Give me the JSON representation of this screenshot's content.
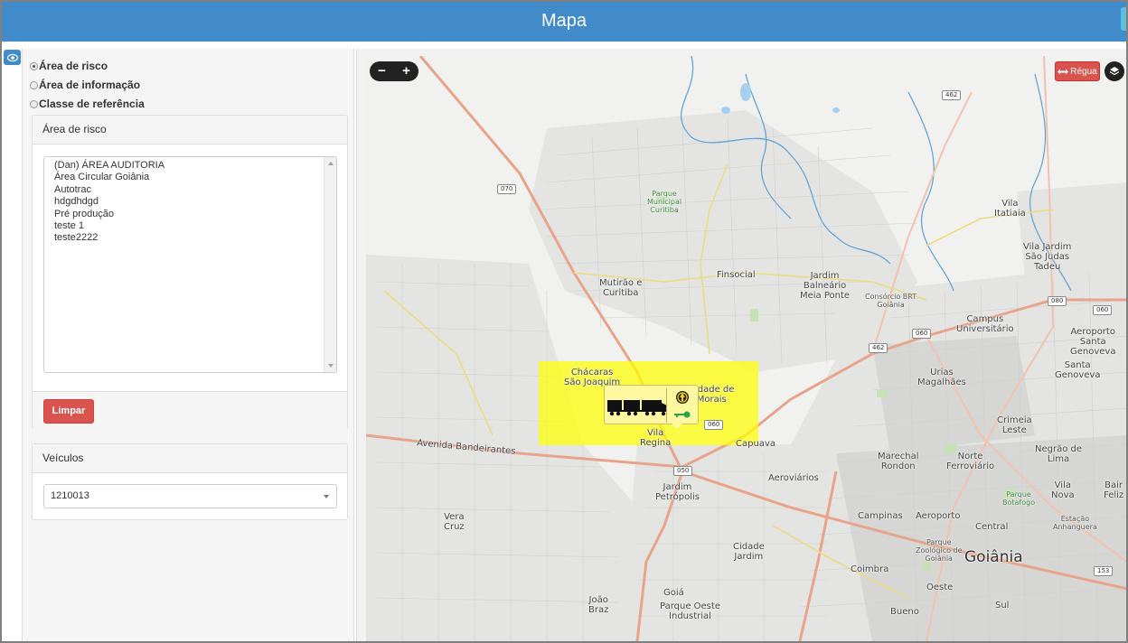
{
  "header": {
    "title": "Mapa"
  },
  "filter": {
    "options": [
      {
        "label": "Área de risco",
        "checked": true
      },
      {
        "label": "Área de informação",
        "checked": false
      },
      {
        "label": "Classe de referência",
        "checked": false
      }
    ]
  },
  "risk_panel": {
    "title": "Área de risco",
    "items": [
      "(Dan) ÁREA AUDITORIA",
      "Área Circular Goiânia",
      "Autotrac",
      "hdgdhdgd",
      "Pré produção",
      "teste 1",
      "teste2222"
    ],
    "clear_label": "Limpar"
  },
  "vehicles_panel": {
    "title": "Veículos",
    "selected": "1210013"
  },
  "map": {
    "zoom_out": "−",
    "zoom_in": "+",
    "ruler_label": "Régua",
    "risk_color": "#ffff00",
    "labels": {
      "parque_municipal": "Parque\nMunicipal\nCuritiba",
      "vila_itatiaia": "Vila\nItatiaia",
      "vila_jardim_sao_judas": "Vila Jardim\nSão Judas\nTadeu",
      "finsocial": "Finsocial",
      "mutirao": "Mutirão e\nCuritiba",
      "jardim_balneario": "Jardim\nBalneário\nMeia Ponte",
      "consorcio": "Consórcio BRT\nGoiânia",
      "campus": "Campus\nUniversitário",
      "aeroporto_santa": "Aeroporto\nSanta\nGenoveva",
      "santa_genoveva": "Santa\nGenoveva",
      "chacaras": "Chácaras\nSão Joaquim",
      "cidade_morais": "Cidade de\nMorais",
      "urias": "Urias\nMagalhães",
      "crimeia": "Crimeia\nLeste",
      "vila_regina": "Vila\nRegina",
      "capuava": "Capuava",
      "avenida": "Avenida Bandeirantes",
      "marechal": "Marechal\nRondon",
      "norte_ferroviario": "Norte\nFerroviário",
      "negrao": "Negrão de\nLima",
      "aeroviarios": "Aeroviários",
      "jardim_petropolis": "Jardim\nPetrópolis",
      "parque_botafogo": "Parque\nBotafogo",
      "vila_nova": "Vila\nNova",
      "bairro_feliz": "Bair\nFeliz",
      "campinas": "Campinas",
      "aeroporto": "Aeroporto",
      "central": "Central",
      "estacao": "Estação\nAnhanguera",
      "vera_cruz": "Vera\nCruz",
      "cidade_jardim": "Cidade\nJardim",
      "zoologico": "Parque\nZoológico de\nGoiânia",
      "goiania": "Goiânia",
      "coimbra": "Coimbra",
      "oeste": "Oeste",
      "joao_braz": "João\nBraz",
      "goia": "Goiá",
      "parque_oeste": "Parque Oeste\nIndustrial",
      "bueno": "Bueno",
      "sul": "Sul"
    },
    "shields": [
      "070",
      "462",
      "080",
      "060",
      "462",
      "060",
      "060",
      "050",
      "153"
    ]
  }
}
